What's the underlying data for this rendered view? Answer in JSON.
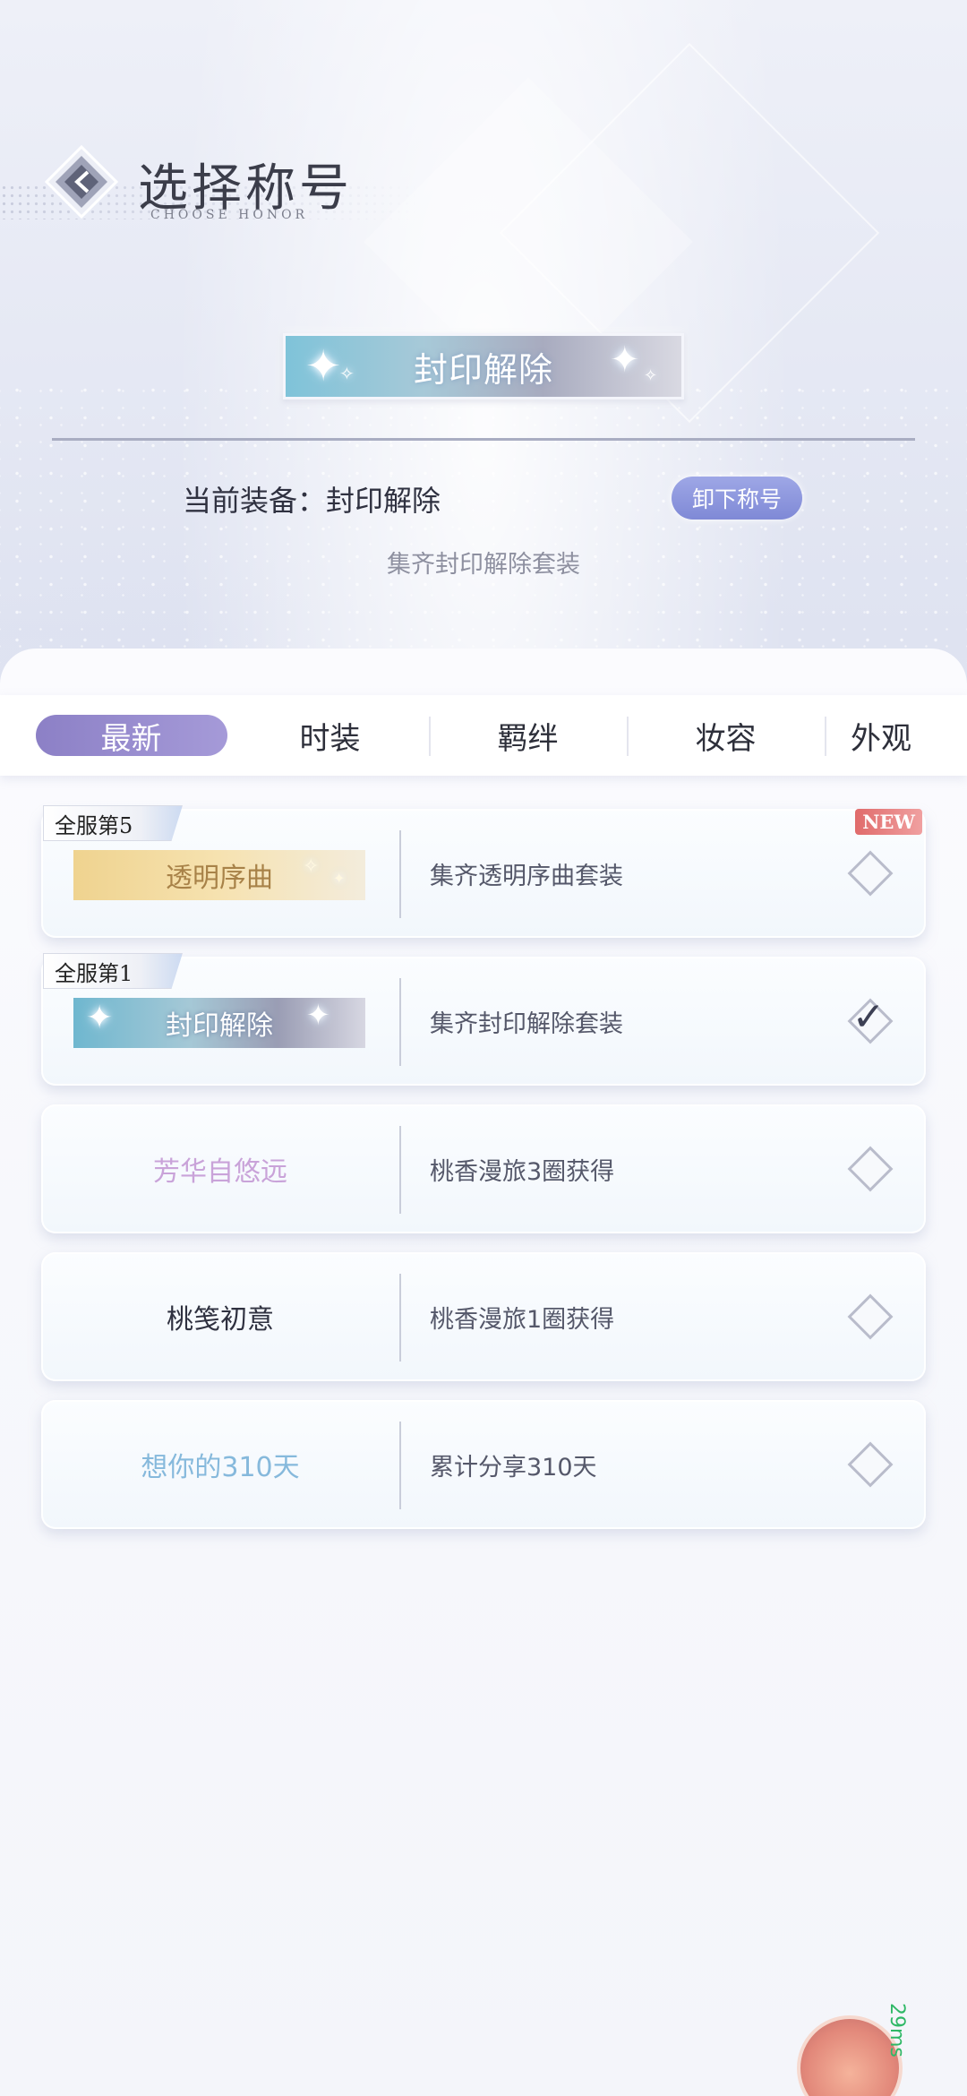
{
  "header": {
    "title": "选择称号",
    "subtitle": "CHOOSE HONOR"
  },
  "current": {
    "badge_text": "封印解除",
    "equip_label": "当前装备：封印解除",
    "unequip_button": "卸下称号",
    "description": "集齐封印解除套装"
  },
  "tabs": [
    {
      "label": "最新",
      "active": true
    },
    {
      "label": "时装",
      "active": false
    },
    {
      "label": "羁绊",
      "active": false
    },
    {
      "label": "妆容",
      "active": false
    },
    {
      "label": "外观",
      "active": false
    }
  ],
  "titles": [
    {
      "rank": "全服第5",
      "name": "透明序曲",
      "style": "gold-chip",
      "description": "集齐透明序曲套装",
      "new_tag": "NEW",
      "equipped": false
    },
    {
      "rank": "全服第1",
      "name": "封印解除",
      "style": "blue-chip",
      "description": "集齐封印解除套装",
      "equipped": true
    },
    {
      "name": "芳华自悠远",
      "style": "text",
      "name_color": "#c9a3d9",
      "description": "桃香漫旅3圈获得",
      "equipped": false
    },
    {
      "name": "桃笺初意",
      "style": "text",
      "name_color": "#2f3140",
      "description": "桃香漫旅1圈获得",
      "equipped": false
    },
    {
      "name": "想你的310天",
      "style": "text",
      "name_color": "#86b9dc",
      "description": "累计分享310天",
      "equipped": false
    }
  ],
  "status": {
    "latency": "29ms"
  },
  "colors": {
    "accent_purple": "#8c80c6",
    "button_blue": "#8a93dd"
  }
}
